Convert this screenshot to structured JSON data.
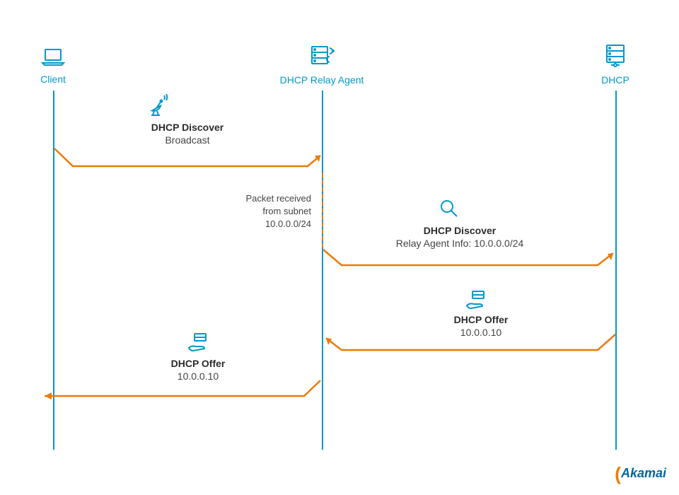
{
  "actors": {
    "client": "Client",
    "relay": "DHCP Relay Agent",
    "dhcp": "DHCP"
  },
  "messages": {
    "discover1": {
      "title": "DHCP Discover",
      "sub": "Broadcast"
    },
    "discover2": {
      "title": "DHCP Discover",
      "sub": "Relay Agent Info: 10.0.0.0/24"
    },
    "offer1": {
      "title": "DHCP Offer",
      "sub": "10.0.0.10"
    },
    "offer2": {
      "title": "DHCP Offer",
      "sub": "10.0.0.10"
    }
  },
  "note": {
    "line1": "Packet received",
    "line2": "from subnet",
    "line3": "10.0.0.0/24"
  },
  "logo": "Akamai",
  "colors": {
    "blue": "#0099cc",
    "orange": "#ec7a08",
    "text": "#2c2c2c"
  }
}
